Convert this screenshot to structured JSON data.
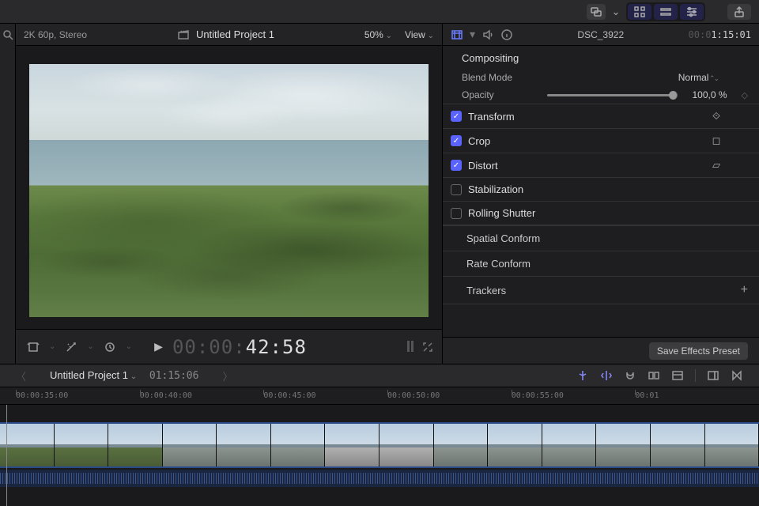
{
  "toolbar": {
    "share_icon": "share-icon"
  },
  "viewer": {
    "format": "2K 60p, Stereo",
    "title": "Untitled Project 1",
    "zoom": "50%",
    "view_label": "View",
    "timecode_dim": "00:00:",
    "timecode_bright": "42:58"
  },
  "inspector": {
    "clip_name": "DSC_3922",
    "clip_tc_dim": "00:0",
    "clip_tc_bright": "1:15:01",
    "sections": {
      "compositing": "Compositing",
      "blend_mode_label": "Blend Mode",
      "blend_mode_value": "Normal",
      "opacity_label": "Opacity",
      "opacity_value": "100,0",
      "opacity_unit": "%"
    },
    "groups": [
      {
        "name": "Transform",
        "checked": true,
        "icon": "⟐"
      },
      {
        "name": "Crop",
        "checked": true,
        "icon": "◻"
      },
      {
        "name": "Distort",
        "checked": true,
        "icon": "▱"
      },
      {
        "name": "Stabilization",
        "checked": false,
        "icon": ""
      },
      {
        "name": "Rolling Shutter",
        "checked": false,
        "icon": ""
      }
    ],
    "plain": [
      "Spatial Conform",
      "Rate Conform"
    ],
    "trackers_label": "Trackers",
    "save_preset": "Save Effects Preset"
  },
  "timeline": {
    "project": "Untitled Project 1",
    "duration": "01:15:06",
    "ruler": [
      "00:00:35:00",
      "00:00:40:00",
      "00:00:45:00",
      "00:00:50:00",
      "00:00:55:00",
      "00:01"
    ]
  }
}
